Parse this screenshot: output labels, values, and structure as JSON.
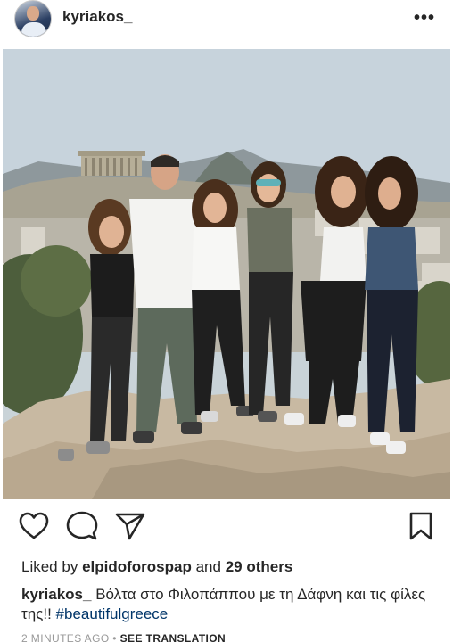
{
  "post": {
    "username": "kyriakos_",
    "more_icon": "more-options-icon",
    "photo_alt": "photo",
    "likes": {
      "prefix": "Liked by",
      "user": "elpidoforospap",
      "connector": "and",
      "others": "29 others"
    },
    "caption": {
      "username": "kyriakos_",
      "text": "Βόλτα στο Φιλοπάππου με τη Δάφνη και τις φίλες της!!",
      "hashtag": "#beautifulgreece"
    },
    "timestamp": "2 MINUTES AGO",
    "separator": "•",
    "see_translation": "SEE TRANSLATION",
    "icons": {
      "like": "heart-icon",
      "comment": "comment-icon",
      "share": "paper-plane-icon",
      "save": "bookmark-icon"
    }
  }
}
